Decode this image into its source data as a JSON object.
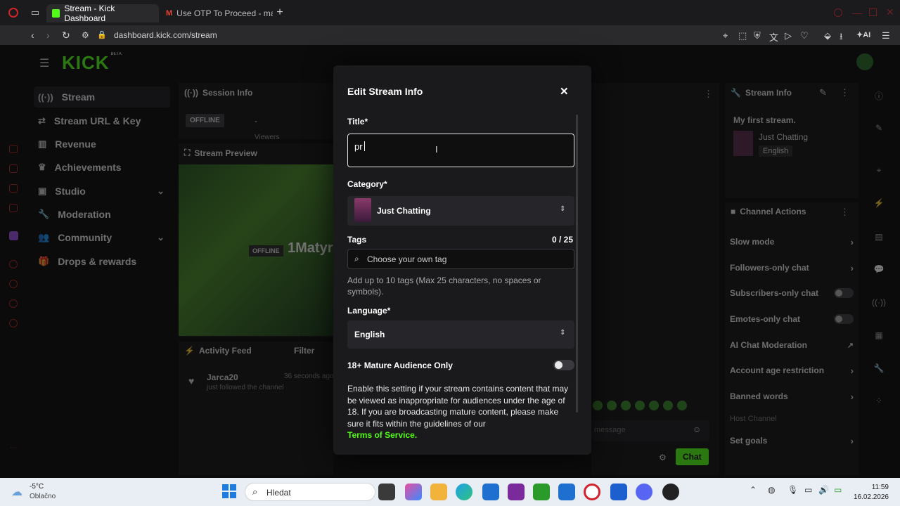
{
  "browser": {
    "tabs": [
      {
        "title": "Stream - Kick Dashboard",
        "active": true
      },
      {
        "title": "Use OTP To Proceed - ma",
        "active": false
      }
    ],
    "url": "dashboard.kick.com/stream",
    "ai_label": "AI"
  },
  "logo": {
    "text": "KICK",
    "beta": "BETA"
  },
  "sidebar": {
    "items": [
      {
        "label": "Stream",
        "icon": "stream-icon"
      },
      {
        "label": "Stream URL & Key",
        "icon": "key-icon"
      },
      {
        "label": "Revenue",
        "icon": "chart-icon"
      },
      {
        "label": "Achievements",
        "icon": "trophy-icon"
      },
      {
        "label": "Studio",
        "icon": "studio-icon"
      },
      {
        "label": "Moderation",
        "icon": "wrench-icon"
      },
      {
        "label": "Community",
        "icon": "people-icon"
      },
      {
        "label": "Drops & rewards",
        "icon": "gift-icon"
      }
    ]
  },
  "session": {
    "title": "Session Info",
    "status": "OFFLINE",
    "dash": "-",
    "viewers_label": "Viewers"
  },
  "preview": {
    "title": "Stream Preview",
    "offline_badge": "OFFLINE",
    "channel": "1Matyr"
  },
  "activity": {
    "title": "Activity Feed",
    "filter": "Filter",
    "entries": [
      {
        "user": "Jarca20",
        "time": "36 seconds ago",
        "text": "just followed the channel"
      }
    ]
  },
  "stream_info": {
    "title": "Stream Info",
    "stream_title": "My first stream.",
    "category": "Just Chatting",
    "language": "English"
  },
  "channel_actions": {
    "title": "Channel Actions",
    "items": [
      {
        "label": "Slow mode",
        "control": "chevron"
      },
      {
        "label": "Followers-only chat",
        "control": "chevron"
      },
      {
        "label": "Subscribers-only chat",
        "control": "toggle"
      },
      {
        "label": "Emotes-only chat",
        "control": "toggle"
      },
      {
        "label": "AI Chat Moderation",
        "control": "external"
      },
      {
        "label": "Account age restriction",
        "control": "chevron"
      },
      {
        "label": "Banned words",
        "control": "chevron"
      },
      {
        "label": "Host Channel",
        "control": "none"
      },
      {
        "label": "Set goals",
        "control": "chevron"
      }
    ]
  },
  "chat": {
    "placeholder": "message",
    "send_label": "Chat"
  },
  "modal": {
    "title": "Edit Stream Info",
    "title_label": "Title*",
    "title_value": "pr",
    "category_label": "Category*",
    "category_value": "Just Chatting",
    "tags_label": "Tags",
    "tags_count": "0 / 25",
    "tags_placeholder": "Choose your own tag",
    "tags_hint": "Add up to 10 tags (Max 25 characters, no spaces or symbols).",
    "language_label": "Language*",
    "language_value": "English",
    "mature_label": "18+ Mature Audience Only",
    "mature_enabled": false,
    "mature_desc": "Enable this setting if your stream contains content that may be viewed as inappropriate for audiences under the age of 18. If you are broadcasting mature content, please make sure it fits within the guidelines of our",
    "tos_link": "Terms of Service",
    "tos_suffix": "."
  },
  "taskbar": {
    "weather_temp": "-5°C",
    "weather_desc": "Oblačno",
    "search_placeholder": "Hledat",
    "time": "11:59",
    "date": "16.02.2026"
  },
  "colors": {
    "accent": "#53fc18",
    "bg": "#0b0b0c",
    "panel": "#141416",
    "modal": "#1a1a1c"
  }
}
